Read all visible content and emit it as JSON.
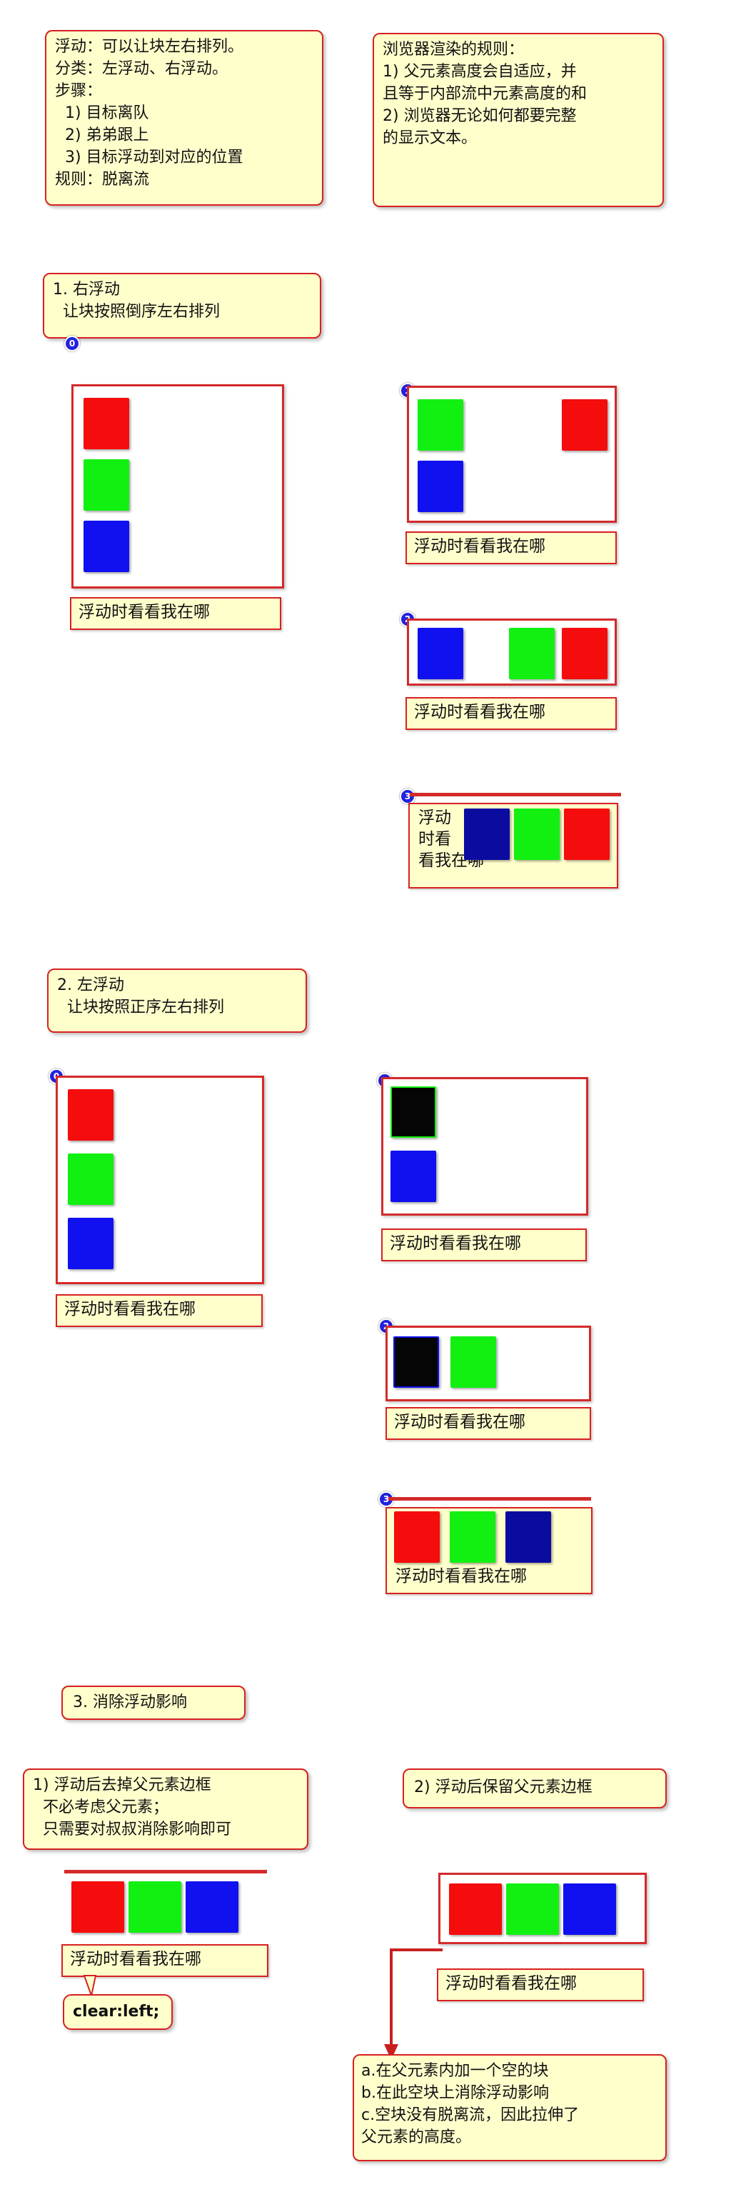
{
  "intro": {
    "lines": [
      "浮动：可以让块左右排列。",
      "分类：左浮动、右浮动。",
      "步骤：",
      "  1) 目标离队",
      "  2) 弟弟跟上",
      "  3) 目标浮动到对应的位置",
      "规则：脱离流"
    ]
  },
  "render_rules": {
    "lines": [
      "浏览器渲染的规则：",
      "1) 父元素高度会自适应，并",
      "且等于内部流中元素高度的和",
      "2) 浏览器无论如何都要完整",
      "的显示文本。"
    ]
  },
  "section1": {
    "title_lines": [
      "1. 右浮动",
      "  让块按照倒序左右排列"
    ]
  },
  "section2": {
    "title_lines": [
      "2. 左浮动",
      "  让块按照正序左右排列"
    ]
  },
  "section3": {
    "title": "3. 消除浮动影响",
    "left_note_lines": [
      "1) 浮动后去掉父元素边框",
      "  不必考虑父元素；",
      "  只需要对叔叔消除影响即可"
    ],
    "right_note": "2) 浮动后保留父元素边框",
    "clear_label": "clear:left;",
    "bottom_note_lines": [
      "a.在父元素内加一个空的块",
      "b.在此空块上消除浮动影响",
      "c.空块没有脱离流，因此拉伸了",
      "父元素的高度。"
    ]
  },
  "demo_text": "浮动时看看我在哪",
  "wrapped_text": [
    "浮动",
    "时看",
    "看我在哪"
  ],
  "badges": [
    "0",
    "1",
    "2",
    "3"
  ],
  "colors": {
    "border": "#d42a2a",
    "note_bg": "#ffffcc",
    "red": "#f50c0c",
    "green": "#12f012",
    "blue": "#1010f0",
    "dark_blue": "#0b0ba0",
    "black": "#050505",
    "badge": "#2222dd"
  }
}
